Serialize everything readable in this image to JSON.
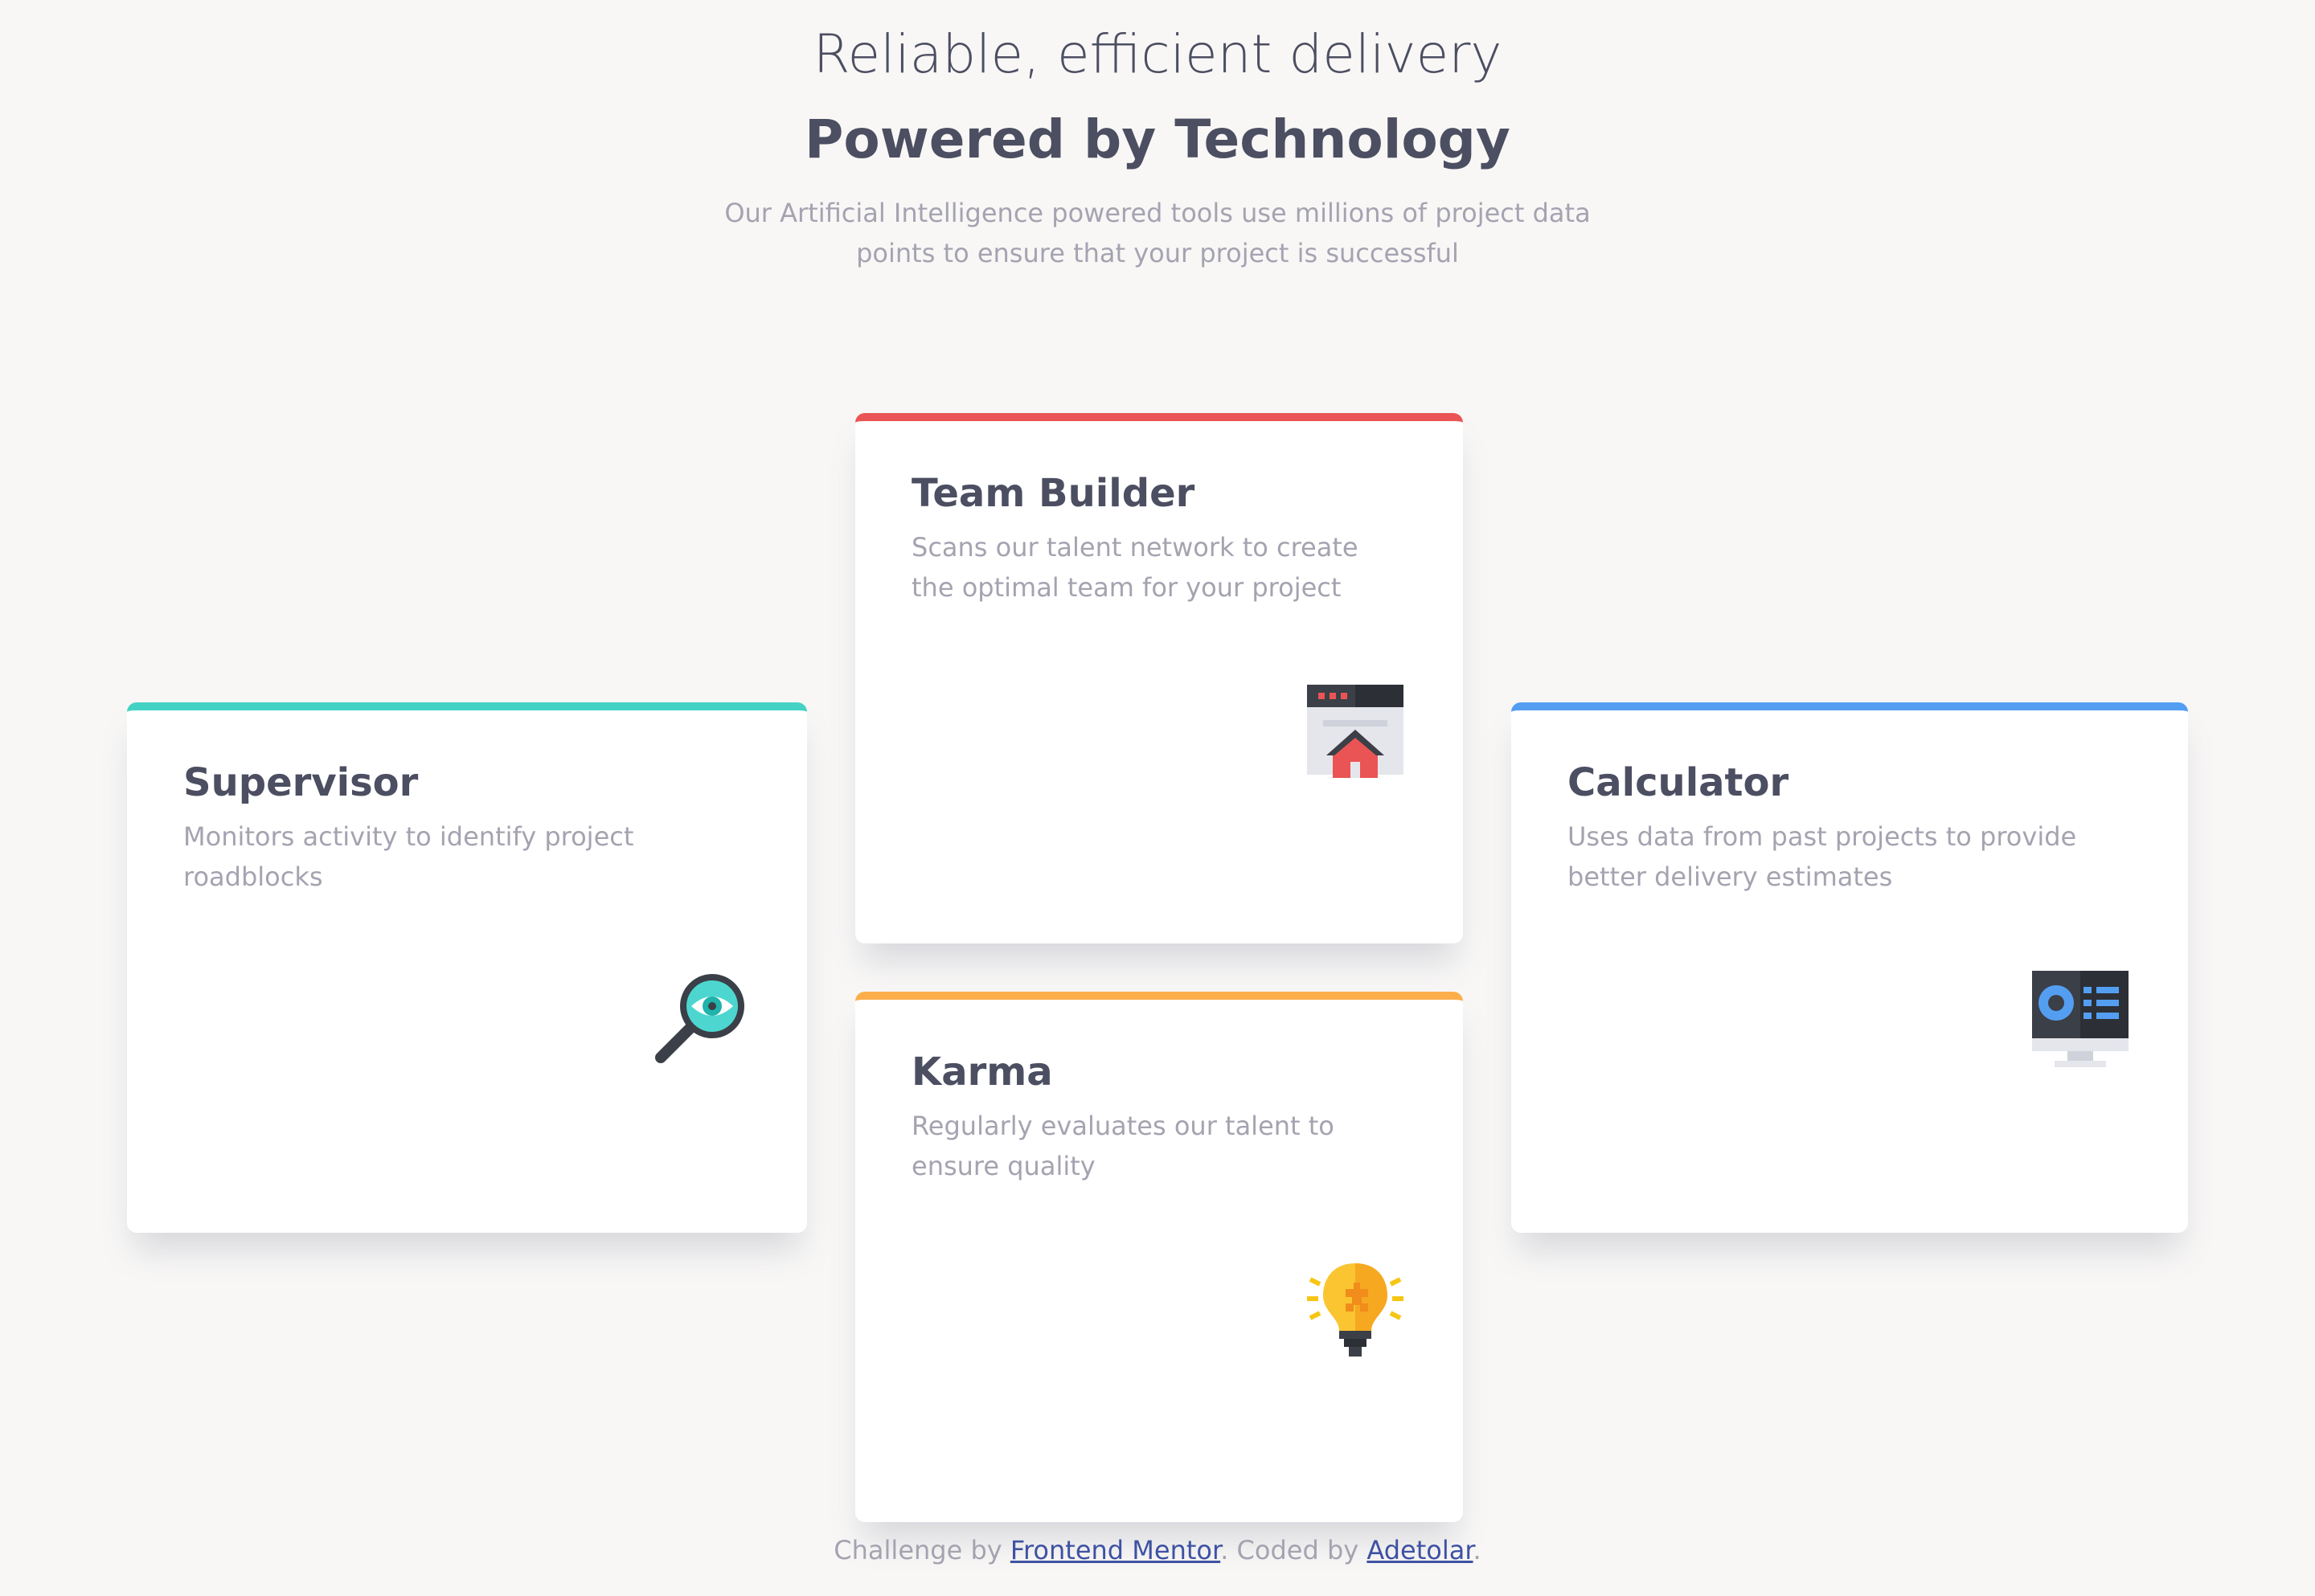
{
  "hero": {
    "line1": "Reliable, efficient delivery",
    "line2": "Powered by Technology",
    "description": "Our Artificial Intelligence powered tools use millions of project data points to ensure that your project is successful"
  },
  "cards": {
    "supervisor": {
      "title": "Supervisor",
      "text": "Monitors activity to identify project roadblocks",
      "icon": "magnifier-eye-icon",
      "accent": "#44d2c5"
    },
    "team_builder": {
      "title": "Team Builder",
      "text": "Scans our talent network to create the optimal team for your project",
      "icon": "browser-house-icon",
      "accent": "#ea5454"
    },
    "karma": {
      "title": "Karma",
      "text": "Regularly evaluates our talent to ensure quality",
      "icon": "lightbulb-icon",
      "accent": "#fcae4a"
    },
    "calculator": {
      "title": "Calculator",
      "text": "Uses data from past projects to provide better delivery estimates",
      "icon": "monitor-chart-icon",
      "accent": "#549ef2"
    }
  },
  "footer": {
    "prefix": "Challenge by",
    "link1": "Frontend Mentor",
    "middle": ". Coded by",
    "link2": "Adetolar",
    "suffix": "."
  },
  "colors": {
    "background": "#f8f7f6",
    "heading": "#4c4e61",
    "body_text": "#a5a3b0",
    "link": "#3e52a3"
  }
}
